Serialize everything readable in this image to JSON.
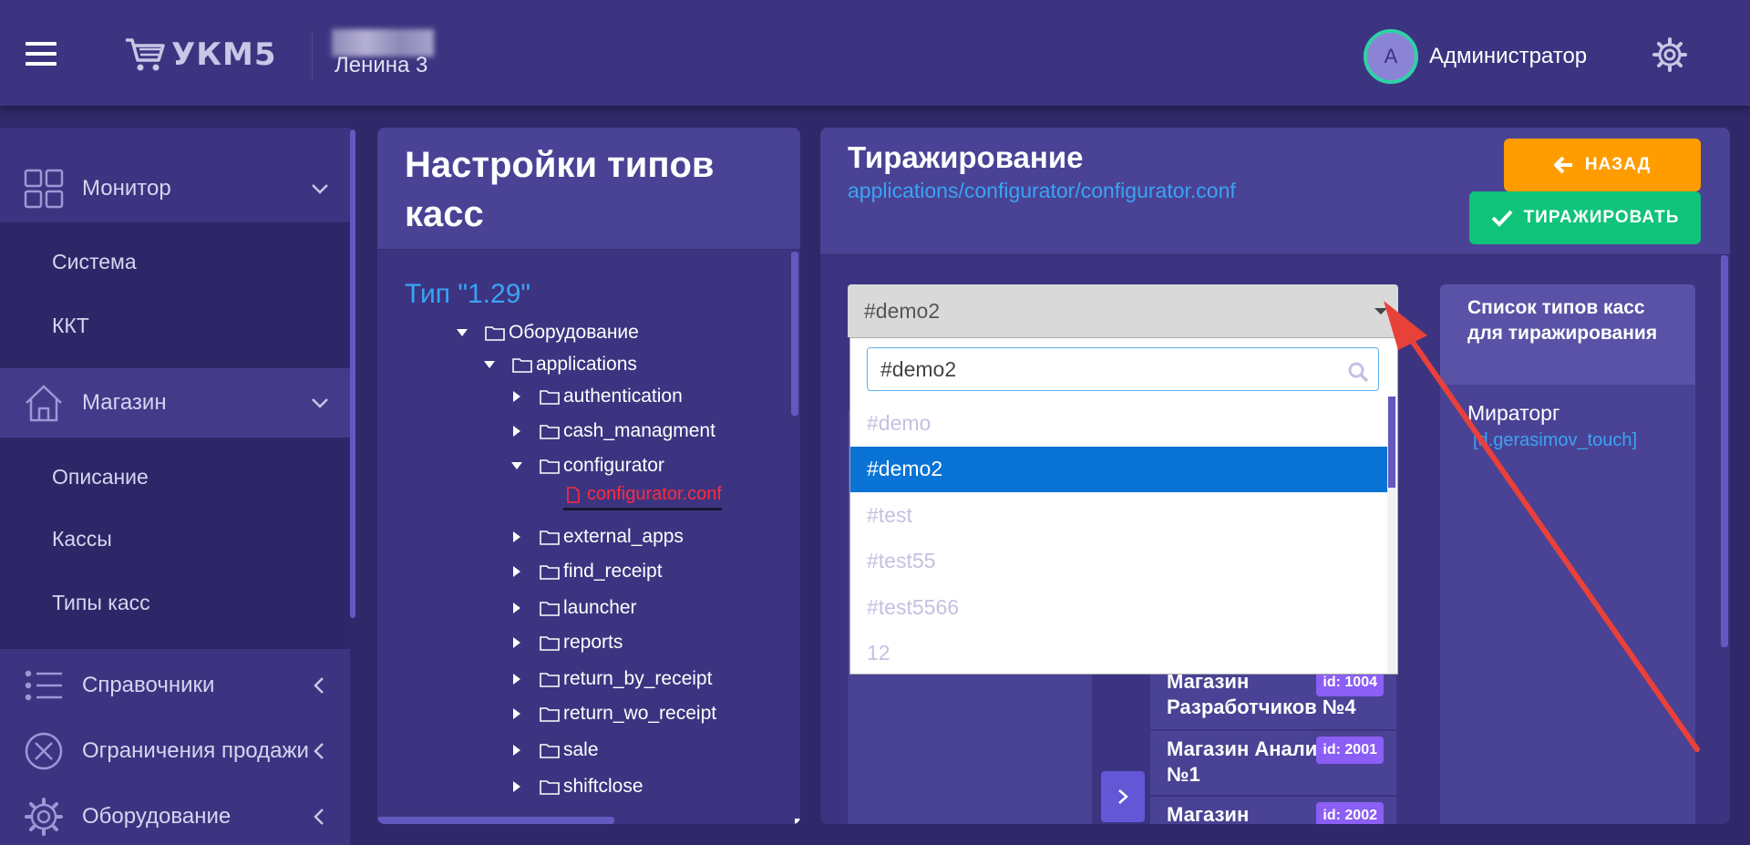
{
  "header": {
    "logo_text": "УКМ5",
    "store_name": "Ленина 3",
    "avatar_letter": "А",
    "user_name": "Администратор"
  },
  "sidebar": {
    "sections": [
      {
        "label": "Монитор",
        "icon": "grid-icon",
        "chevron": "down"
      },
      {
        "label": "Магазин",
        "icon": "house-icon",
        "chevron": "down"
      },
      {
        "label": "Справочники",
        "icon": "list-icon",
        "chevron": "left"
      },
      {
        "label": "Ограничения продажи",
        "icon": "cancel-circle-icon",
        "chevron": "left"
      },
      {
        "label": "Оборудование",
        "icon": "gear-icon",
        "chevron": "left"
      }
    ],
    "monitor_sub": [
      "Система",
      "ККТ"
    ],
    "store_sub": [
      "Описание",
      "Кассы",
      "Типы касс"
    ]
  },
  "left_panel": {
    "title": "Настройки типов касс",
    "type_label": "Тип \"1.29\"",
    "tree": [
      {
        "label": "Оборудование",
        "level": 0,
        "open": true
      },
      {
        "label": "applications",
        "level": 1,
        "open": true
      },
      {
        "label": "authentication",
        "level": 2,
        "open": false
      },
      {
        "label": "cash_managment",
        "level": 2,
        "open": false
      },
      {
        "label": "configurator",
        "level": 2,
        "open": true
      },
      {
        "label": "configurator.conf",
        "level": 3,
        "file": true
      },
      {
        "label": "external_apps",
        "level": 2,
        "open": false
      },
      {
        "label": "find_receipt",
        "level": 2,
        "open": false
      },
      {
        "label": "launcher",
        "level": 2,
        "open": false
      },
      {
        "label": "reports",
        "level": 2,
        "open": false
      },
      {
        "label": "return_by_receipt",
        "level": 2,
        "open": false
      },
      {
        "label": "return_wo_receipt",
        "level": 2,
        "open": false
      },
      {
        "label": "sale",
        "level": 2,
        "open": false
      },
      {
        "label": "shiftclose",
        "level": 2,
        "open": false
      }
    ]
  },
  "right_panel": {
    "title": "Тиражирование",
    "path": "applications/configurator/configurator.conf",
    "back_label": "НАЗАД",
    "replicate_label": "ТИРАЖИРОВАТЬ",
    "select_value": "#demo2",
    "search_value": "#demo2",
    "options": [
      "#demo",
      "#demo2",
      "#test",
      "#test55",
      "#test5566",
      "12"
    ],
    "selected_option": "#demo2",
    "stores": [
      {
        "name": "Магазин Разработчиков №4",
        "id": "id: 1004"
      },
      {
        "name": "Магазин Аналитиков №1",
        "id": "id: 2001"
      },
      {
        "name": "Магазин",
        "id": "id: 2002"
      }
    ],
    "list_title": "Список типов касс для тиражирования",
    "list_item": "Мираторг",
    "list_item_sub": "[d.gerasimov_touch]"
  },
  "colors": {
    "background": "#2f2869",
    "panel": "#3c3480",
    "accent_blue": "#3aa4f3",
    "back_button": "#ff9d00",
    "replicate_button": "#0fc37a",
    "selected_option": "#0a73d6",
    "annotation_arrow": "#e8413a"
  }
}
